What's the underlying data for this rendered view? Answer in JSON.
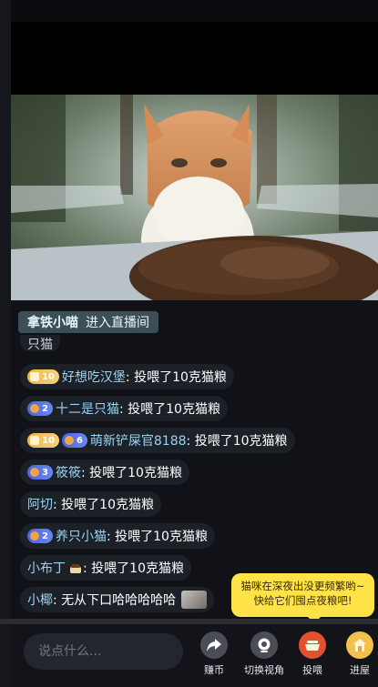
{
  "chat": {
    "partial_text": "只猫",
    "join_banner": {
      "name": "拿铁小喵",
      "text": "进入直播间"
    },
    "messages": [
      {
        "badges": [
          {
            "type": "gold",
            "level": "10"
          }
        ],
        "name": "好想吃汉堡",
        "text": ": 投喂了10克猫粮"
      },
      {
        "badges": [
          {
            "type": "blue",
            "level": "2"
          }
        ],
        "name": "十二是只猫",
        "text": ": 投喂了10克猫粮"
      },
      {
        "badges": [
          {
            "type": "gold",
            "level": "10"
          },
          {
            "type": "blue",
            "level": "6"
          }
        ],
        "name": "萌新铲屎官8188",
        "text": ": 投喂了10克猫粮"
      },
      {
        "badges": [
          {
            "type": "blue",
            "level": "3"
          }
        ],
        "name": "筱筱",
        "text": ": 投喂了10克猫粮"
      },
      {
        "badges": [],
        "name": "阿切",
        "text": ": 投喂了10克猫粮"
      },
      {
        "badges": [
          {
            "type": "blue",
            "level": "2"
          }
        ],
        "name": "养只小猫",
        "text": ": 投喂了10克猫粮"
      },
      {
        "badges": [],
        "name": "小布丁",
        "text": ": 投喂了10克猫粮",
        "emoji": "pudding-icon"
      },
      {
        "badges": [],
        "name": "小椰",
        "text": ": 无从下口哈哈哈哈哈",
        "image": "thumbnail-image"
      }
    ]
  },
  "tooltip": {
    "text": "猫咪在深夜出没更频繁哟~快给它们囤点夜粮吧!"
  },
  "bottom_bar": {
    "input_placeholder": "说点什么...",
    "actions": [
      {
        "label": "赚币",
        "icon": "share-arrow-icon"
      },
      {
        "label": "切换视角",
        "icon": "camera-icon"
      },
      {
        "label": "投喂",
        "icon": "food-bowl-icon"
      },
      {
        "label": "进屋",
        "icon": "house-icon"
      }
    ]
  },
  "colors": {
    "name": "#9ad3f3",
    "gold_badge": "#f0b64a",
    "blue_badge": "#4b67d8",
    "tooltip": "#ffe347",
    "feed_button": "#e2502e"
  }
}
